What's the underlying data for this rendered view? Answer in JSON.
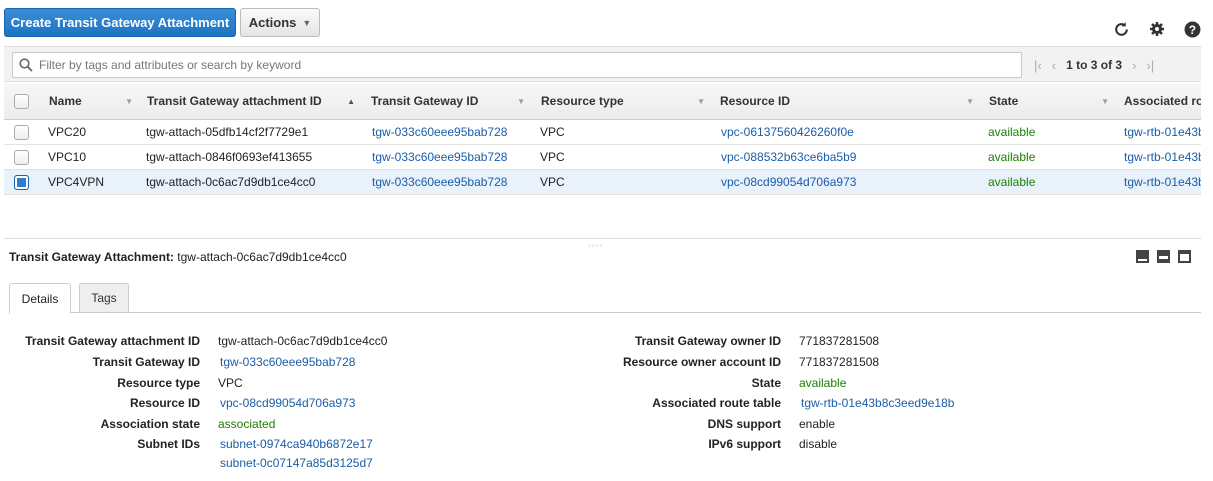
{
  "toolbar": {
    "create_label": "Create Transit Gateway Attachment",
    "actions_label": "Actions"
  },
  "icons": [
    "refresh-icon",
    "gear-icon",
    "help-icon",
    "search-icon",
    "first-page-icon",
    "prev-page-icon",
    "next-page-icon",
    "last-page-icon"
  ],
  "filter": {
    "placeholder": "Filter by tags and attributes or search by keyword"
  },
  "pager": {
    "text": "1 to 3 of 3"
  },
  "table": {
    "columns": [
      "Name",
      "Transit Gateway attachment ID",
      "Transit Gateway ID",
      "Resource type",
      "Resource ID",
      "State",
      "Associated ro"
    ],
    "rows": [
      {
        "name": "VPC20",
        "attachment_id": "tgw-attach-05dfb14cf2f7729e1",
        "tgw_id": "tgw-033c60eee95bab728",
        "resource_type": "VPC",
        "resource_id": "vpc-06137560426260f0e",
        "state": "available",
        "assoc": "tgw-rtb-01e43b",
        "selected": false
      },
      {
        "name": "VPC10",
        "attachment_id": "tgw-attach-0846f0693ef413655",
        "tgw_id": "tgw-033c60eee95bab728",
        "resource_type": "VPC",
        "resource_id": "vpc-088532b63ce6ba5b9",
        "state": "available",
        "assoc": "tgw-rtb-01e43b",
        "selected": false
      },
      {
        "name": "VPC4VPN",
        "attachment_id": "tgw-attach-0c6ac7d9db1ce4cc0",
        "tgw_id": "tgw-033c60eee95bab728",
        "resource_type": "VPC",
        "resource_id": "vpc-08cd99054d706a973",
        "state": "available",
        "assoc": "tgw-rtb-01e43b",
        "selected": true
      }
    ]
  },
  "detail": {
    "title_label": "Transit Gateway Attachment:",
    "title_value": "tgw-attach-0c6ac7d9db1ce4cc0",
    "tabs": [
      "Details",
      "Tags"
    ],
    "left": [
      {
        "label": "Transit Gateway attachment ID",
        "value": "tgw-attach-0c6ac7d9db1ce4cc0",
        "kind": "text"
      },
      {
        "label": "Transit Gateway ID",
        "value": "tgw-033c60eee95bab728",
        "kind": "link"
      },
      {
        "label": "Resource type",
        "value": "VPC",
        "kind": "text"
      },
      {
        "label": "Resource ID",
        "value": "vpc-08cd99054d706a973",
        "kind": "link"
      },
      {
        "label": "Association state",
        "value": "associated",
        "kind": "ok"
      },
      {
        "label": "Subnet IDs",
        "value": "subnet-0974ca940b6872e17",
        "kind": "link"
      }
    ],
    "subnet_2": "subnet-0c07147a85d3125d7",
    "right": [
      {
        "label": "Transit Gateway owner ID",
        "value": "771837281508",
        "kind": "text"
      },
      {
        "label": "Resource owner account ID",
        "value": "771837281508",
        "kind": "text"
      },
      {
        "label": "State",
        "value": "available",
        "kind": "ok"
      },
      {
        "label": "Associated route table",
        "value": "tgw-rtb-01e43b8c3eed9e18b",
        "kind": "link"
      },
      {
        "label": "DNS support",
        "value": "enable",
        "kind": "text"
      },
      {
        "label": "IPv6 support",
        "value": "disable",
        "kind": "text"
      }
    ]
  }
}
